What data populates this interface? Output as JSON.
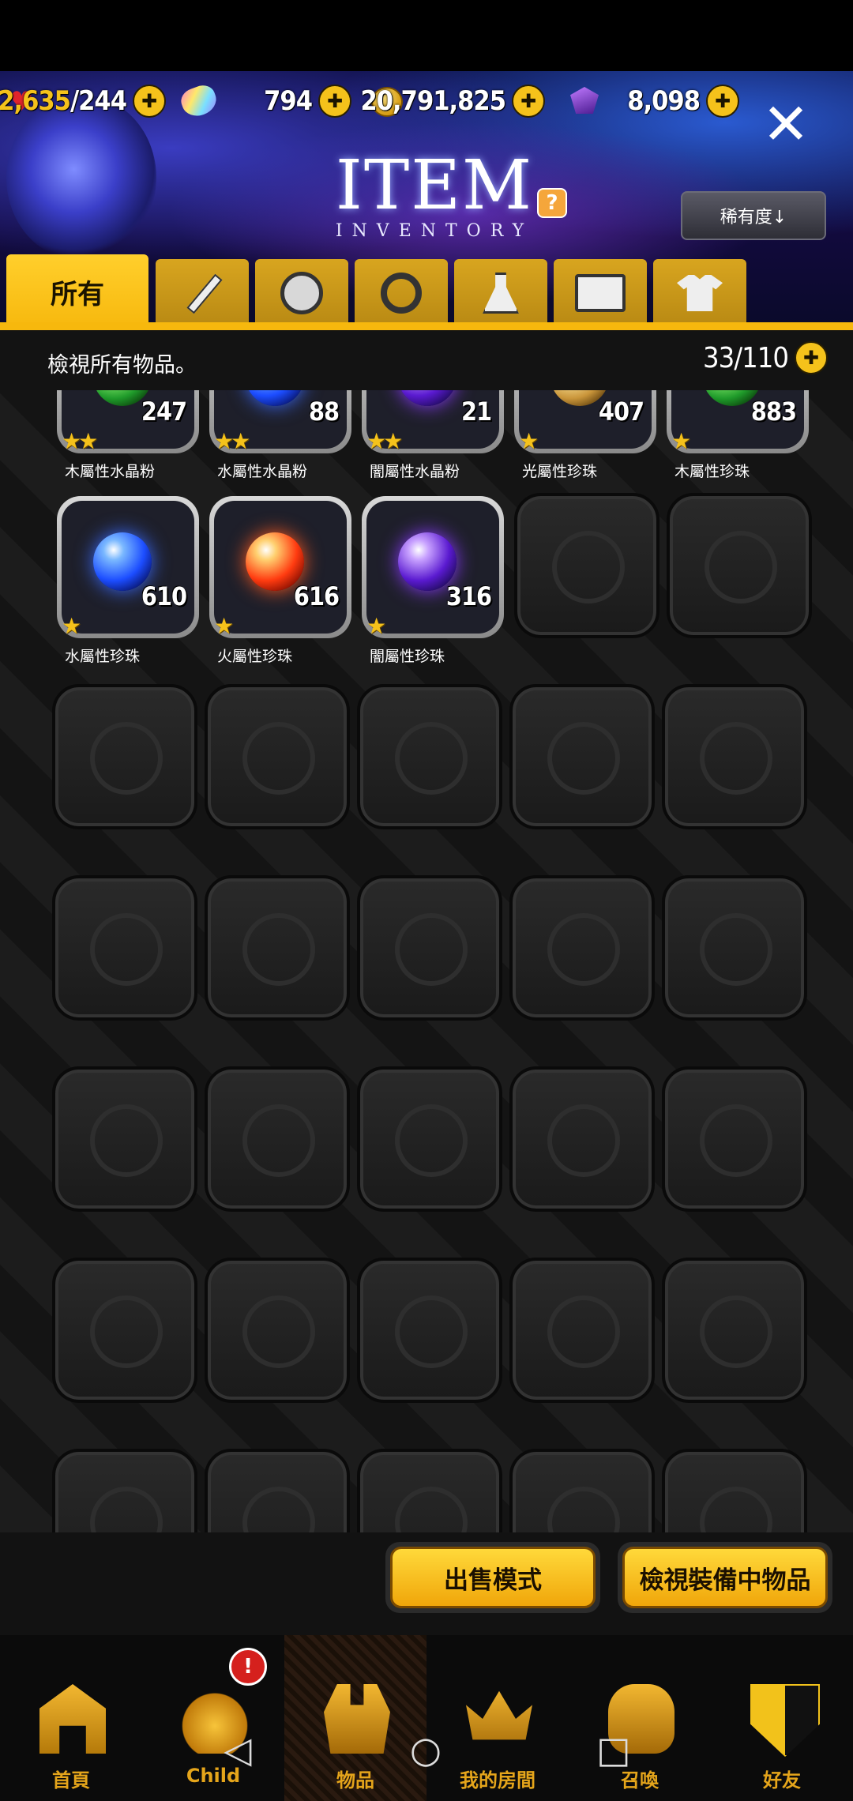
{
  "resources": {
    "stamina_current": "2,635",
    "stamina_max": "/244",
    "gems": "794",
    "gold": "20,791,825",
    "crystals": "8,098"
  },
  "header": {
    "title": "ITEM",
    "subtitle": "INVENTORY",
    "help": "?",
    "sort_label": "稀有度↓"
  },
  "tabs": [
    {
      "label": "所有",
      "icon": "all"
    },
    {
      "label": "",
      "icon": "sword-icon"
    },
    {
      "label": "",
      "icon": "shield-icon"
    },
    {
      "label": "",
      "icon": "ring-icon"
    },
    {
      "label": "",
      "icon": "flask-icon"
    },
    {
      "label": "",
      "icon": "card-icon"
    },
    {
      "label": "",
      "icon": "shirt-icon"
    }
  ],
  "info": {
    "text": "檢視所有物品。",
    "capacity": "33/110"
  },
  "items_row1": [
    {
      "name": "木屬性水晶粉",
      "count": "247",
      "stars": "★★",
      "element": "wood"
    },
    {
      "name": "水屬性水晶粉",
      "count": "88",
      "stars": "★★",
      "element": "water"
    },
    {
      "name": "闇屬性水晶粉",
      "count": "21",
      "stars": "★★",
      "element": "dark"
    },
    {
      "name": "光屬性珍珠",
      "count": "407",
      "stars": "★",
      "element": "light"
    },
    {
      "name": "木屬性珍珠",
      "count": "883",
      "stars": "★",
      "element": "wood"
    }
  ],
  "items_row2": [
    {
      "name": "水屬性珍珠",
      "count": "610",
      "stars": "★",
      "element": "water"
    },
    {
      "name": "火屬性珍珠",
      "count": "616",
      "stars": "★",
      "element": "fire"
    },
    {
      "name": "闇屬性珍珠",
      "count": "316",
      "stars": "★",
      "element": "dark"
    }
  ],
  "actions": {
    "sell_mode": "出售模式",
    "view_equipped": "檢視裝備中物品"
  },
  "nav": [
    {
      "label": "首頁",
      "icon": "home-icon"
    },
    {
      "label": "Child",
      "icon": "child-icon"
    },
    {
      "label": "物品",
      "icon": "items-icon"
    },
    {
      "label": "我的房間",
      "icon": "room-icon"
    },
    {
      "label": "召喚",
      "icon": "summon-icon"
    },
    {
      "label": "好友",
      "icon": "friends-icon"
    }
  ],
  "nav_badge": "!"
}
